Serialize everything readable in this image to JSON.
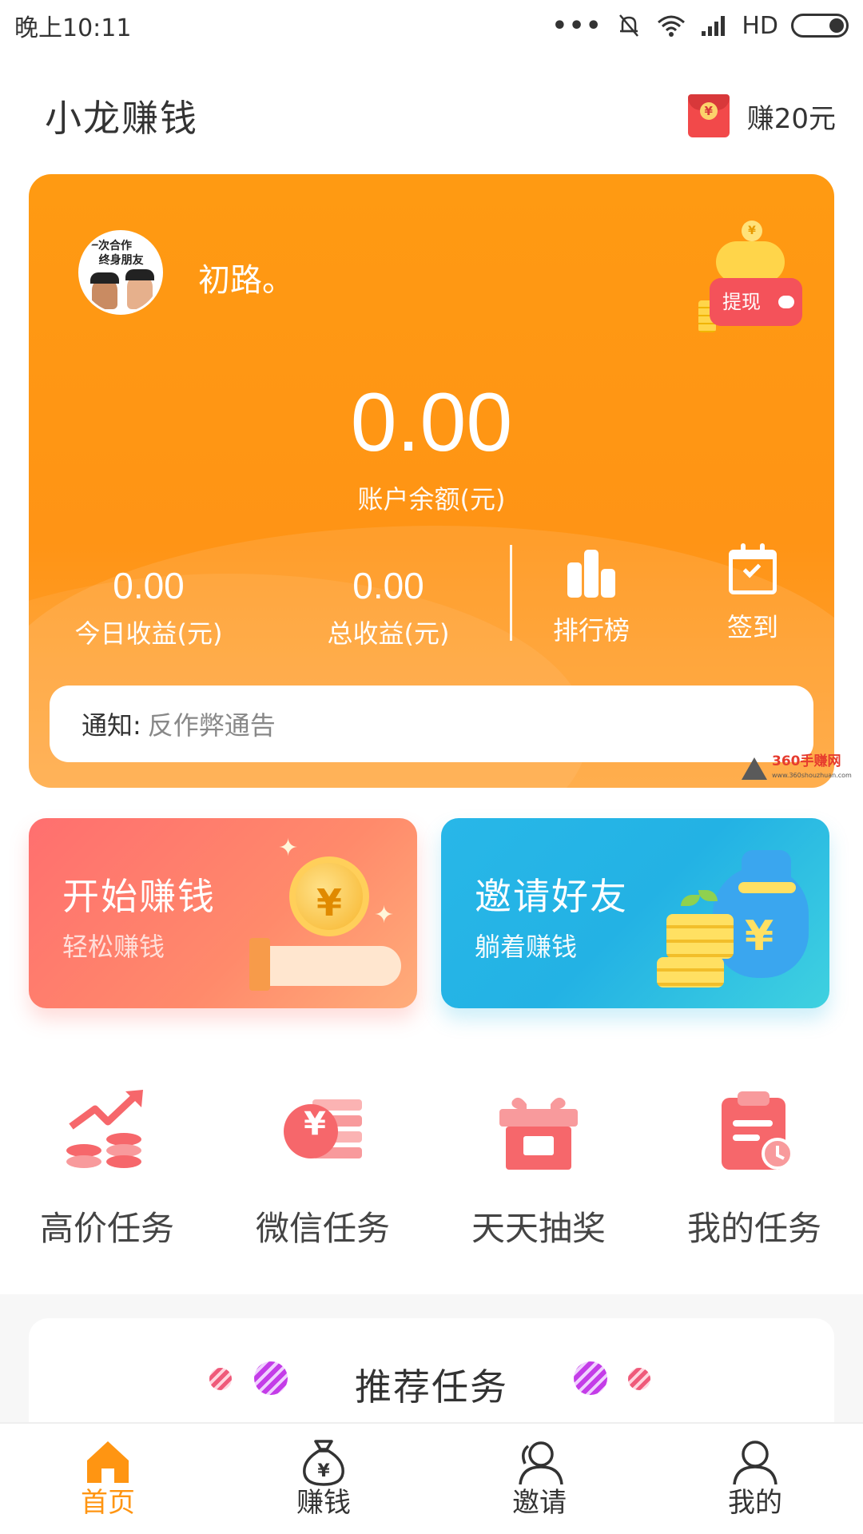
{
  "status_bar": {
    "time": "晚上10:11",
    "dots": "•••",
    "network": "HD",
    "icons": [
      "mute-icon",
      "wifi-icon",
      "signal-icon",
      "battery-icon"
    ]
  },
  "header": {
    "app_title": "小龙赚钱",
    "earn_label": "赚20元",
    "earn_icon": "red-envelope-icon"
  },
  "balance_card": {
    "user_name": "初路。",
    "avatar_caption": "一次合作\n终身朋友",
    "withdraw_label": "提现",
    "withdraw_coin_symbol": "¥",
    "balance": "0.00",
    "balance_label": "账户余额(元)",
    "stats": [
      {
        "value": "0.00",
        "label": "今日收益(元)"
      },
      {
        "value": "0.00",
        "label": "总收益(元)"
      }
    ],
    "quick_links": [
      {
        "label": "排行榜",
        "icon": "ranking-bars-icon"
      },
      {
        "label": "签到",
        "icon": "calendar-check-icon"
      }
    ],
    "notice": {
      "label": "通知:",
      "text": "反作弊通告"
    },
    "accent": "#ff9512"
  },
  "watermark": {
    "brand": "360手赚网",
    "url": "www.360shouzhuan.com"
  },
  "promos": [
    {
      "title": "开始赚钱",
      "subtitle": "轻松赚钱",
      "icon": "coin-hand-icon",
      "yen": "¥"
    },
    {
      "title": "邀请好友",
      "subtitle": "躺着赚钱",
      "icon": "money-bag-icon",
      "yen": "¥"
    }
  ],
  "features": [
    {
      "label": "高价任务",
      "icon": "trend-coins-icon"
    },
    {
      "label": "微信任务",
      "icon": "yen-coin-icon",
      "yen": "¥"
    },
    {
      "label": "天天抽奖",
      "icon": "gift-box-icon"
    },
    {
      "label": "我的任务",
      "icon": "clipboard-clock-icon"
    }
  ],
  "recommend": {
    "title": "推荐任务"
  },
  "tabs": [
    {
      "label": "首页",
      "icon": "home-icon",
      "active": true
    },
    {
      "label": "赚钱",
      "icon": "money-bag-icon",
      "yen": "¥"
    },
    {
      "label": "邀请",
      "icon": "invite-users-icon"
    },
    {
      "label": "我的",
      "icon": "user-icon"
    }
  ],
  "colors": {
    "orange": "#ff9512",
    "promo_red": "#ff6f6f",
    "promo_blue": "#28b7e8",
    "icon_coral": "#f6676b"
  }
}
